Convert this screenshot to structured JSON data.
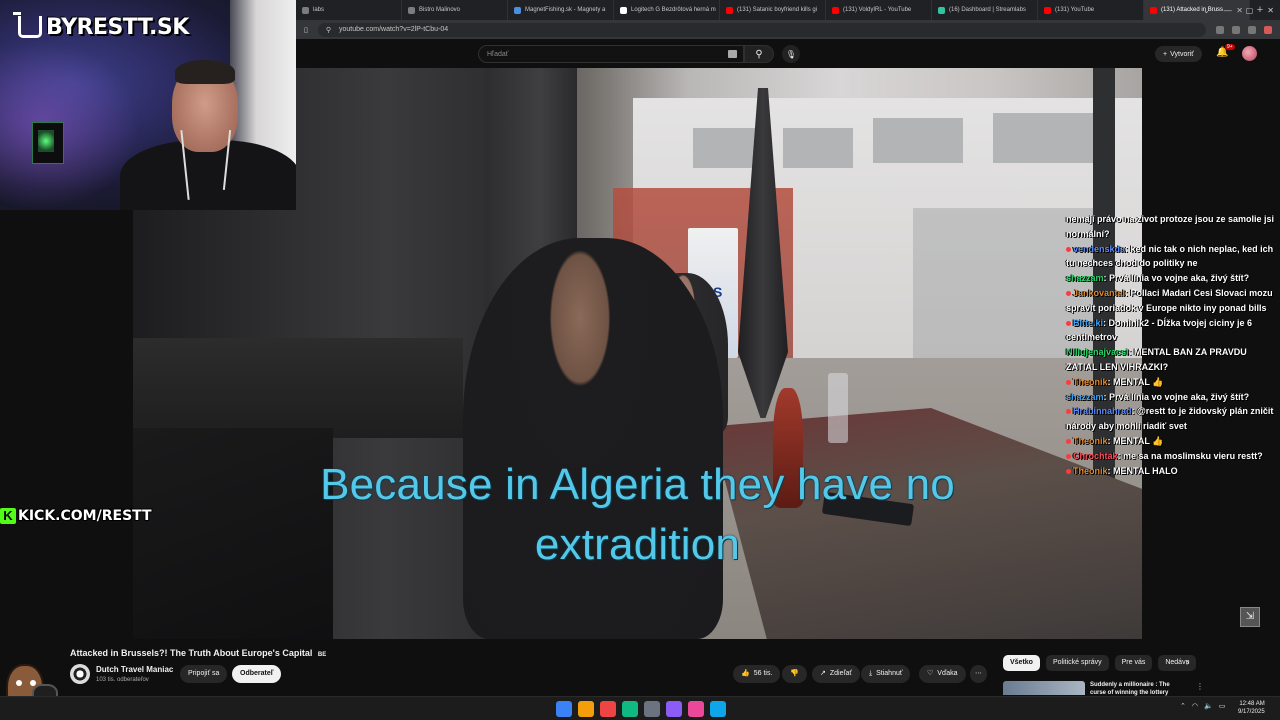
{
  "browser": {
    "tabs": [
      {
        "label": "labs",
        "color": "#7c7c7c"
      },
      {
        "label": "Bistro Malinovo",
        "color": "#7c7c7c"
      },
      {
        "label": "MagnetFishing.sk - Magnety a",
        "color": "#4a90e2"
      },
      {
        "label": "Logitech G Bezdrôtová herná m",
        "color": "#ffffff"
      },
      {
        "label": "(131) Satanic boyfriend kills gi",
        "color": "#ff0000"
      },
      {
        "label": "(131) VoldyIRL - YouTube",
        "color": "#ff0000"
      },
      {
        "label": "(16) Dashboard | Streamlabs",
        "color": "#31c3a2"
      },
      {
        "label": "(131) YouTube",
        "color": "#ff0000"
      },
      {
        "label": "(131) Attacked in Bruss",
        "color": "#ff0000",
        "active": true
      }
    ],
    "new_tab_label": "+",
    "url": "youtube.com/watch?v=2lP-tCbu-04"
  },
  "masthead": {
    "search_placeholder": "Hľadať",
    "create_label": "Vytvoriť",
    "notification_count": "9+"
  },
  "overlay": {
    "logo_text": "BYRESTT.SK",
    "kick_text": "KICK.COM/RESTT"
  },
  "video": {
    "caption_line1": "Because in Algeria they have no",
    "caption_line2": "extradition",
    "cafe_sign": "PS"
  },
  "chat": [
    {
      "user": "",
      "text": "nemají právo na zivot protoze jsou ze samolie jsi normální?",
      "color": ""
    },
    {
      "user": "vendenskda",
      "text": "ked nic tak o nich neplac, ked ich tu nechces chod do politiky ne",
      "color": "blue",
      "dot": true
    },
    {
      "user": "shazzam",
      "text": "Prvá línia vo vojne aka, živý štít?",
      "color": "green"
    },
    {
      "user": "Jankovantal",
      "text": "Pollaci Madari Cesi Slovaci mozu spravit poriadok v Europe nikto iny ponad bills",
      "color": "orange",
      "dot": true
    },
    {
      "user": "Bitte.ki",
      "text": "Dominik2 - Dĺžka tvojej ciciny je 6 centimetrov",
      "color": "blue2",
      "dot": true
    },
    {
      "user": "Nillujenajvacsi",
      "text": "MENTAL BAN ZA PRAVDU ZATIAL LEN VIHRAZKI?",
      "color": "green"
    },
    {
      "user": "Theonik",
      "text": "MENTAL 👍",
      "color": "orange",
      "dot": true
    },
    {
      "user": "shazzam",
      "text": "Prvá línia vo vojne aka, živý štít?",
      "color": "blue2"
    },
    {
      "user": "Hrabinnahrad",
      "text": "@restt to je židovský plán zničit národy aby mohli riadiť svet",
      "color": "blue",
      "dot": true
    },
    {
      "user": "Theonik",
      "text": "MENTAL 👍",
      "color": "orange",
      "dot": true
    },
    {
      "user": "Chrochtak",
      "text": "me sa na moslimsku vieru restt?",
      "color": "red",
      "dot": true
    },
    {
      "user": "Theonik",
      "text": "MENTAL HALO",
      "color": "orange",
      "dot": true
    }
  ],
  "info": {
    "title": "Attacked in Brussels?! The Truth About Europe's Capital",
    "title_flag": "BE",
    "channel_name": "Dutch Travel Maniac",
    "subscribers": "103 tis. odberateľov",
    "join_label": "Pripojiť sa",
    "subscribe_label": "Odberateľ",
    "likes": "56 tis.",
    "share_label": "Zdieľať",
    "download_label": "Stiahnuť",
    "thanks_label": "Vďaka",
    "more_label": "⋯",
    "chips": [
      "Všetko",
      "Politické správy",
      "Pre vás",
      "Nedávn"
    ],
    "rec_title": "Suddenly a millionaire : The curse of winning the lottery"
  },
  "taskbar": {
    "time": "12:48 AM",
    "date": "9/17/2025",
    "icon_colors": [
      "#3b82f6",
      "#f59e0b",
      "#ef4444",
      "#10b981",
      "#6b7280",
      "#8b5cf6",
      "#ec4899",
      "#0ea5e9"
    ]
  }
}
